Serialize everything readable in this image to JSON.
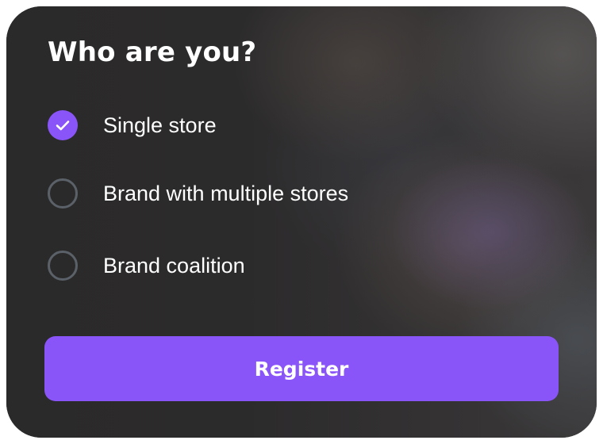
{
  "form": {
    "title": "Who are you?",
    "options": [
      {
        "label": "Single store",
        "checked": true
      },
      {
        "label": "Brand with multiple stores",
        "checked": false
      },
      {
        "label": "Brand coalition",
        "checked": false
      }
    ],
    "submit_label": "Register"
  },
  "colors": {
    "accent": "#8a55f8",
    "radio_border": "#5b6168",
    "card_background": "#2e2d2d",
    "text": "#ffffff"
  },
  "icons": {
    "checked_option": "check-icon"
  }
}
